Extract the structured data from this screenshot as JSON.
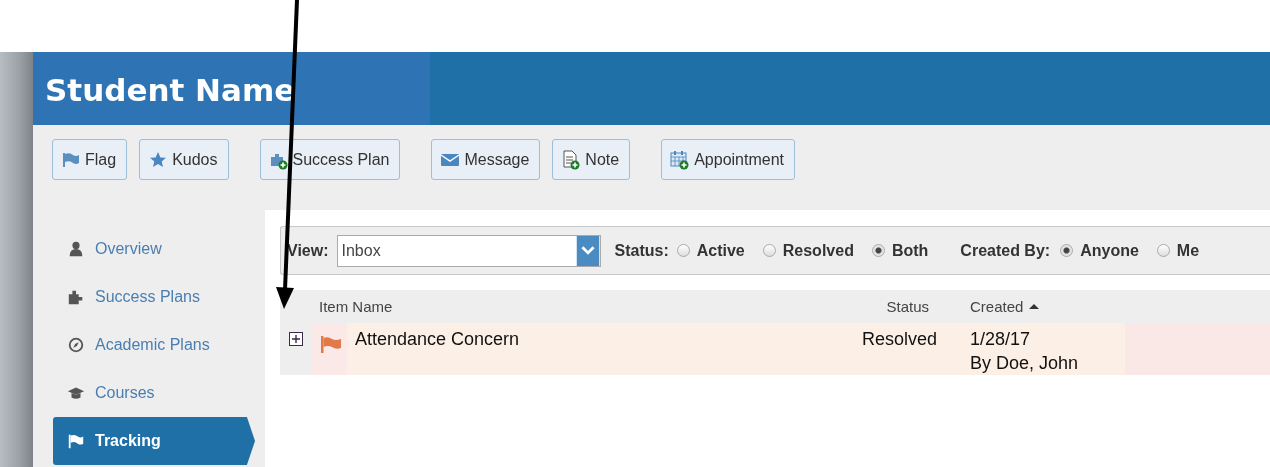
{
  "window": {
    "title": "Student Name"
  },
  "toolbar": [
    {
      "label": "Flag",
      "kind": "flag"
    },
    {
      "label": "Kudos",
      "kind": "star"
    },
    {
      "label": "Success Plan",
      "kind": "puzzle-add"
    },
    {
      "label": "Message",
      "kind": "envelope"
    },
    {
      "label": "Note",
      "kind": "note-add"
    },
    {
      "label": "Appointment",
      "kind": "calendar-add"
    }
  ],
  "sidebar": {
    "items": [
      {
        "label": "Overview",
        "kind": "person",
        "selected": false
      },
      {
        "label": "Success Plans",
        "kind": "puzzle",
        "selected": false
      },
      {
        "label": "Academic Plans",
        "kind": "compass",
        "selected": false
      },
      {
        "label": "Courses",
        "kind": "cap",
        "selected": false
      },
      {
        "label": "Tracking",
        "kind": "flag",
        "selected": true
      }
    ]
  },
  "filters": {
    "view": {
      "label": "View:",
      "value": "Inbox"
    },
    "status": {
      "label": "Status:",
      "options": [
        {
          "label": "Active",
          "selected": false
        },
        {
          "label": "Resolved",
          "selected": false
        },
        {
          "label": "Both",
          "selected": true
        }
      ]
    },
    "created_by": {
      "label": "Created By:",
      "options": [
        {
          "label": "Anyone",
          "selected": true
        },
        {
          "label": "Me",
          "selected": false
        }
      ]
    }
  },
  "table": {
    "columns": [
      {
        "label": "Item Name"
      },
      {
        "label": "Status"
      },
      {
        "label": "Created",
        "sort_ascending": true
      }
    ],
    "rows": [
      {
        "expanded": false,
        "color": "#e07a4a",
        "name": "Attendance Concern",
        "status": "Resolved",
        "created": "1/28/17",
        "created_by": "By Doe, John"
      }
    ]
  }
}
